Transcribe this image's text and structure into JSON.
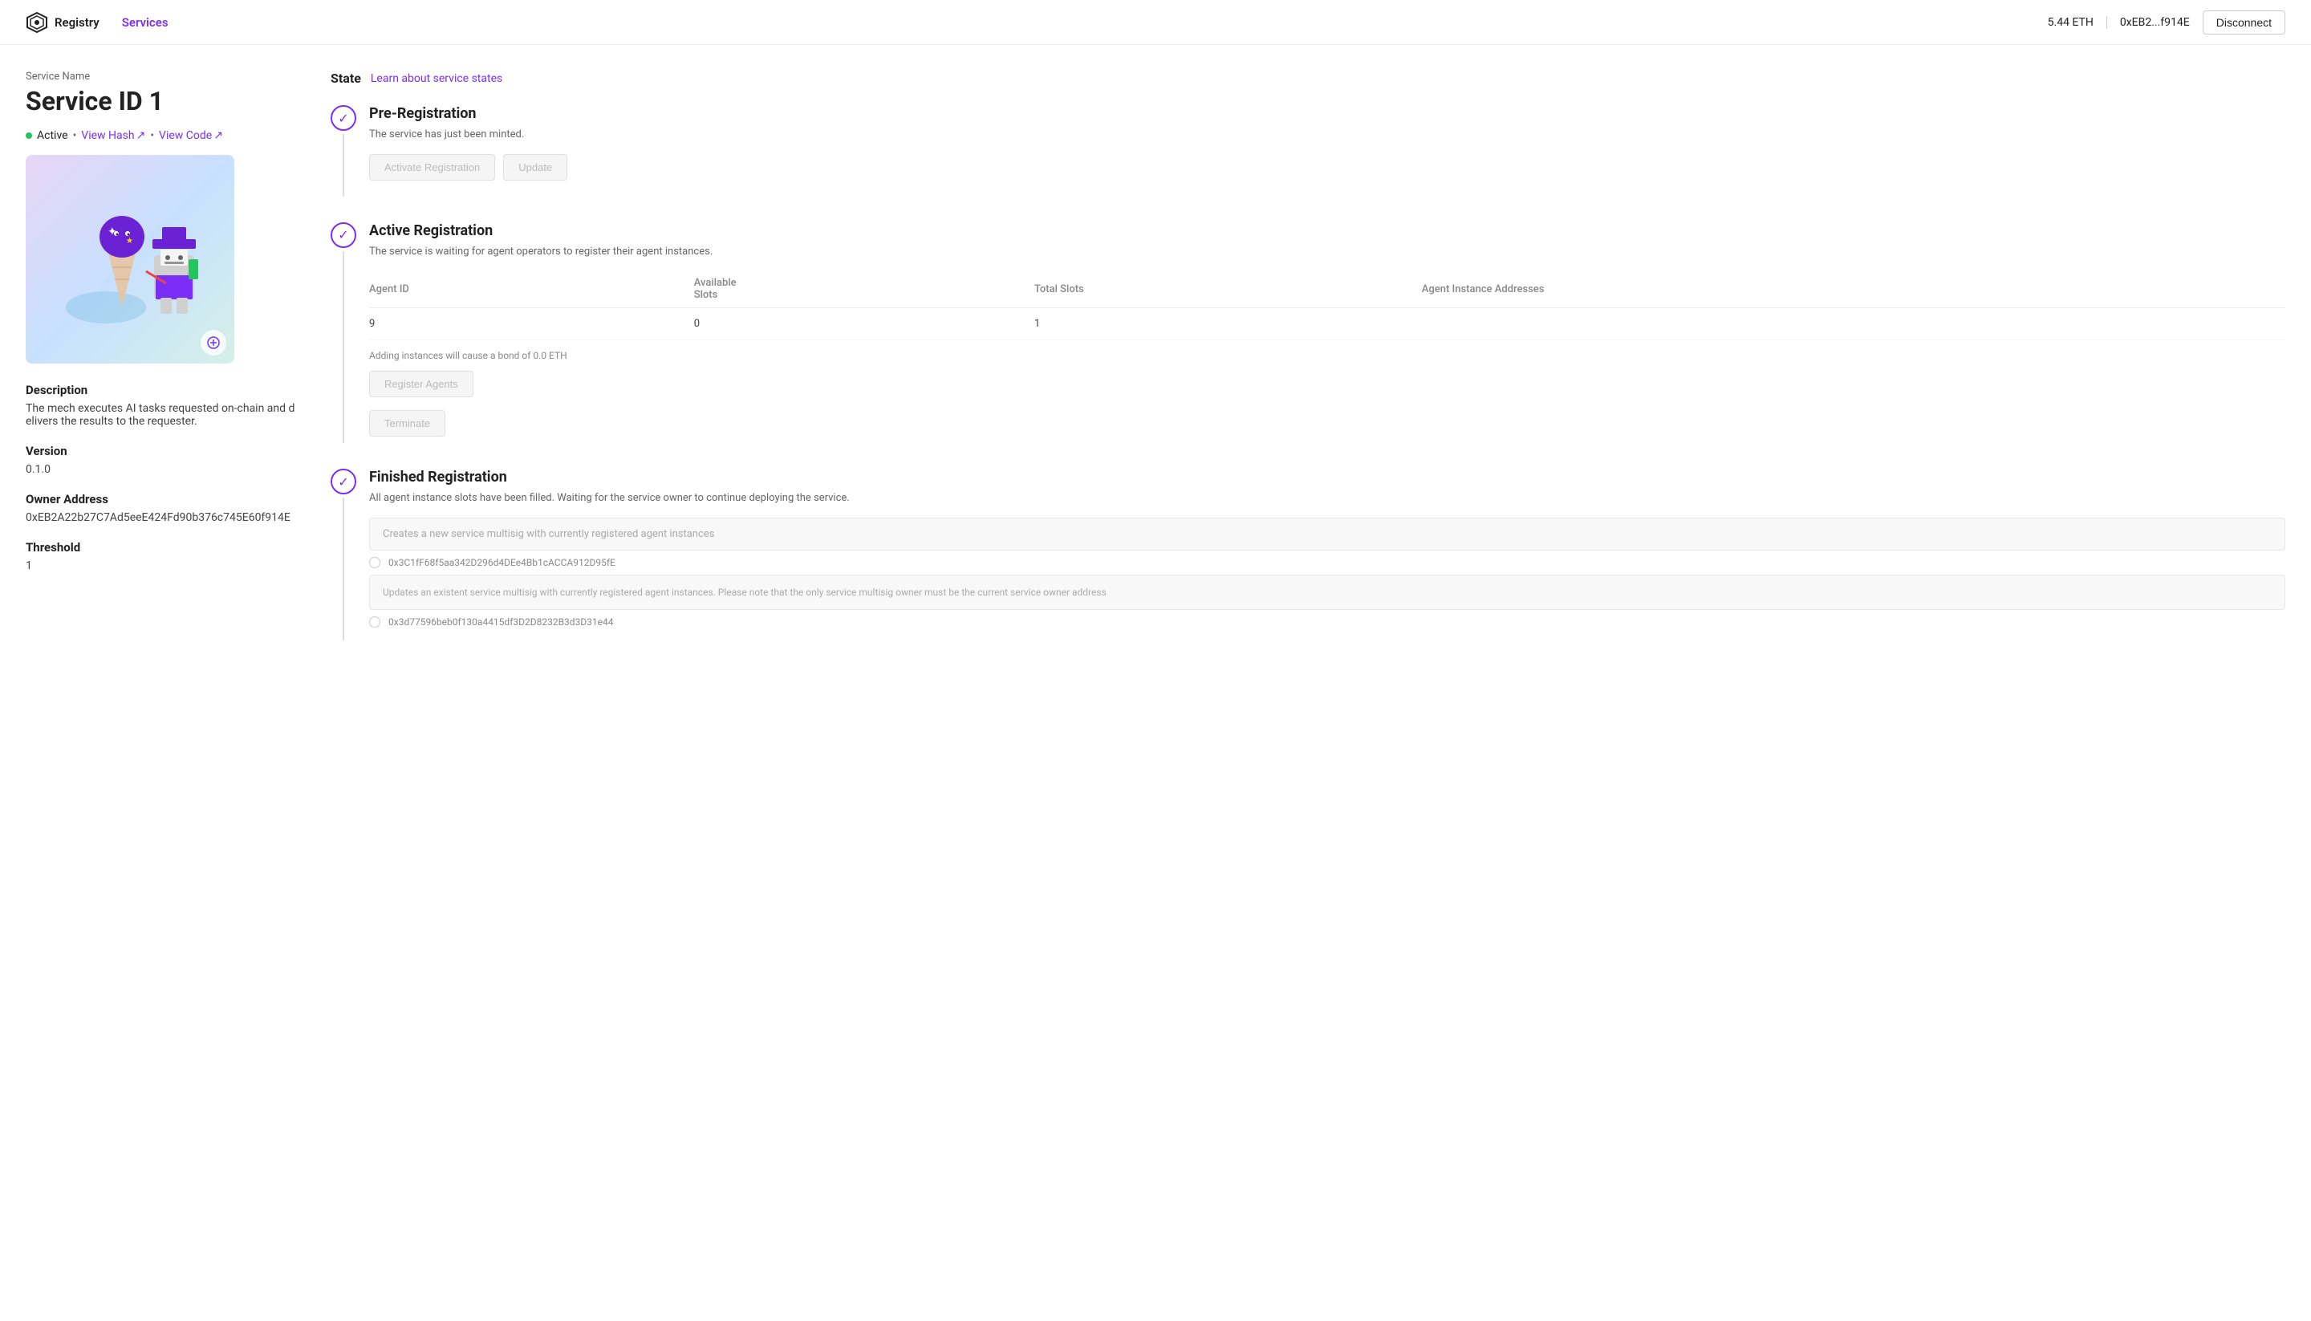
{
  "app": {
    "logo_text": "Registry",
    "nav_link": "Services"
  },
  "wallet": {
    "balance": "5.44 ETH",
    "address": "0xEB2...f914E",
    "disconnect": "Disconnect"
  },
  "service": {
    "name_label": "Service Name",
    "title": "Service ID 1",
    "status": "Active",
    "view_hash": "View Hash",
    "view_hash_arrow": "↗",
    "view_code": "View Code",
    "view_code_arrow": "↗",
    "separator": "•",
    "description_label": "Description",
    "description": "The mech executes AI tasks requested on-chain and delivers the results to the requester.",
    "version_label": "Version",
    "version": "0.1.0",
    "owner_label": "Owner Address",
    "owner": "0xEB2A22b27C7Ad5eeE424Fd90b376c745E60f914E",
    "threshold_label": "Threshold",
    "threshold": "1"
  },
  "state": {
    "label": "State",
    "learn_link": "Learn about service states",
    "steps": [
      {
        "id": "pre-registration",
        "title": "Pre-Registration",
        "desc": "The service has just been minted.",
        "checked": true,
        "buttons": [
          {
            "label": "Activate Registration",
            "disabled": true
          },
          {
            "label": "Update",
            "disabled": true
          }
        ]
      },
      {
        "id": "active-registration",
        "title": "Active Registration",
        "desc": "The service is waiting for agent operators to register their agent instances.",
        "checked": true,
        "table": {
          "headers": [
            "Agent ID",
            "Available Slots",
            "Total Slots",
            "Agent Instance Addresses"
          ],
          "rows": [
            {
              "agent_id": "9",
              "available_slots": "0",
              "total_slots": "1",
              "addresses": ""
            }
          ]
        },
        "bond_note": "Adding instances will cause a bond of 0.0 ETH",
        "register_btn": "Register Agents",
        "terminate_btn": "Terminate"
      },
      {
        "id": "finished-registration",
        "title": "Finished Registration",
        "desc": "All agent instance slots have been filled. Waiting for the service owner to continue deploying the service.",
        "checked": true,
        "multisig_create_label": "Creates a new service multisig with currently registered agent instances",
        "multisig_create_value": "0x3C1fF68f5aa342D296d4DEe4Bb1cACCA912D95fE",
        "multisig_update_label": "Updates an existent service multisig with currently registered agent instances. Please note that the only service multisig owner must be the current service owner address",
        "multisig_update_value": "0x3d77596beb0f130a4415df3D2D8232B3d3D31e44"
      }
    ]
  }
}
